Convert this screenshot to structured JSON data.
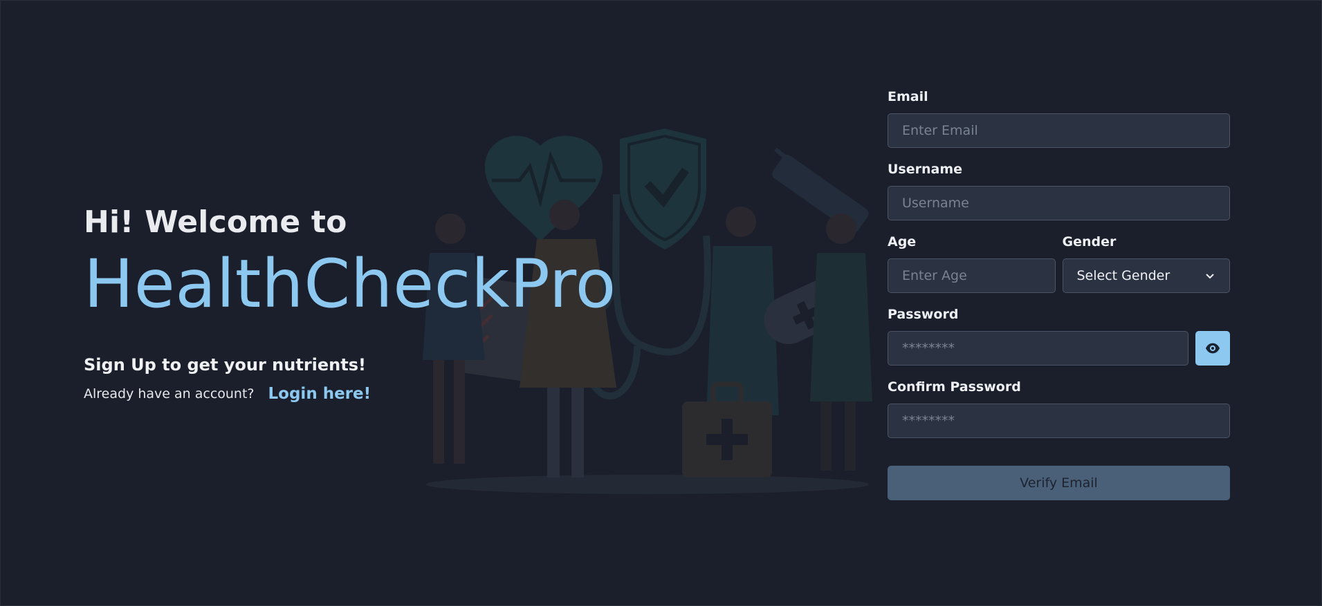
{
  "hero": {
    "greeting": "Hi! Welcome to",
    "brand": "HealthCheckPro",
    "subtitle": "Sign Up to get your nutrients!",
    "account_prompt": "Already have an account?",
    "login_link": "Login here!"
  },
  "form": {
    "email": {
      "label": "Email",
      "placeholder": "Enter Email",
      "value": ""
    },
    "username": {
      "label": "Username",
      "placeholder": "Username",
      "value": ""
    },
    "age": {
      "label": "Age",
      "placeholder": "Enter Age",
      "value": ""
    },
    "gender": {
      "label": "Gender",
      "selected": "Select Gender",
      "icon": "chevron-down-icon"
    },
    "password": {
      "label": "Password",
      "placeholder": "********",
      "value": "",
      "toggle_icon": "eye-icon"
    },
    "confirm_password": {
      "label": "Confirm Password",
      "placeholder": "********",
      "value": ""
    },
    "submit_label": "Verify Email"
  },
  "colors": {
    "background": "#1b1f2b",
    "accent": "#8cc8f0",
    "input_bg": "#2b3242",
    "button_disabled": "#4a6078"
  }
}
